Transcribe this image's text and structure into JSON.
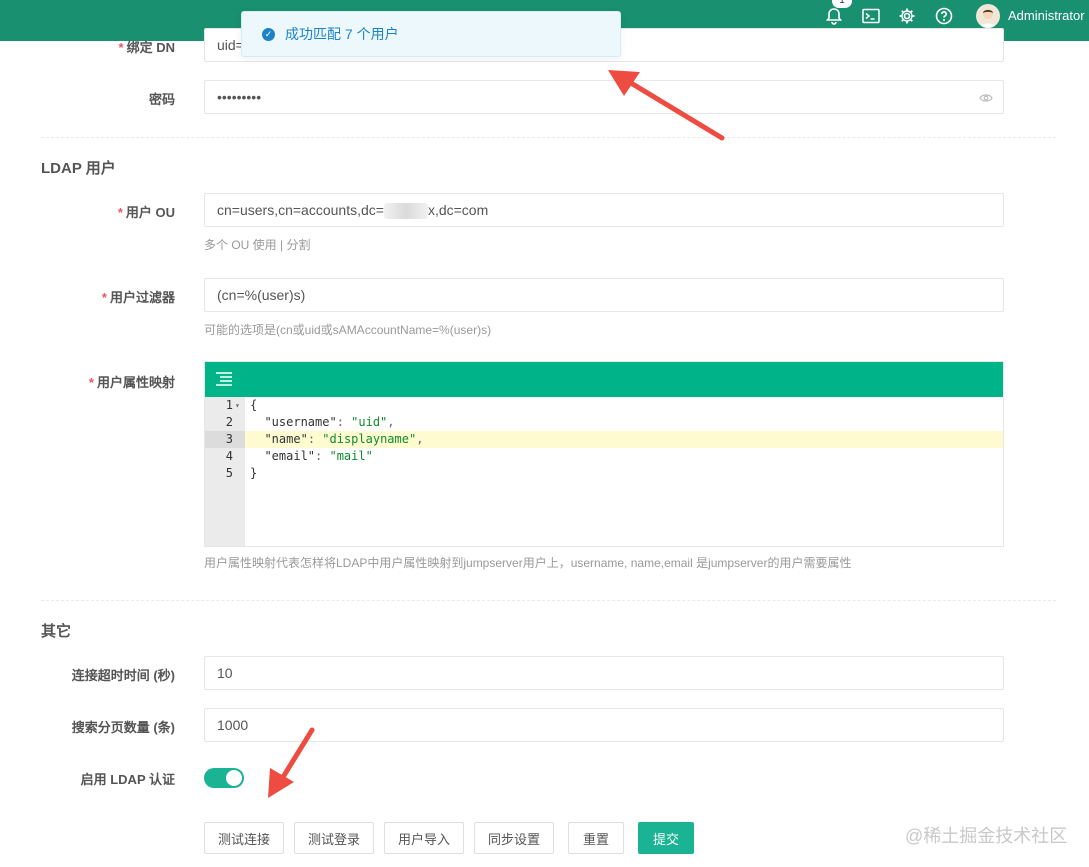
{
  "header": {
    "notification_count": "1",
    "user_name": "Administrator"
  },
  "toast": {
    "message": "成功匹配 7 个用户"
  },
  "form": {
    "bind_dn": {
      "label": "绑定 DN",
      "value": "uid="
    },
    "password": {
      "label": "密码",
      "value": "•••••••••"
    },
    "ldap_users_section": "LDAP 用户",
    "user_ou": {
      "label": "用户 OU",
      "value_prefix": "cn=users,cn=accounts,dc=",
      "value_suffix": "x,dc=com",
      "help": "多个 OU 使用 | 分割"
    },
    "user_filter": {
      "label": "用户过滤器",
      "value": "(cn=%(user)s)",
      "help": "可能的选项是(cn或uid或sAMAccountName=%(user)s)"
    },
    "attr_map": {
      "label": "用户属性映射",
      "lines": [
        {
          "n": "1",
          "open": "{"
        },
        {
          "n": "2",
          "key": "\"username\"",
          "val": "\"uid\"",
          "trail": ","
        },
        {
          "n": "3",
          "key": "\"name\"",
          "val": "\"displayname\"",
          "trail": ","
        },
        {
          "n": "4",
          "key": "\"email\"",
          "val": "\"mail\"",
          "trail": ""
        },
        {
          "n": "5",
          "open": "}"
        }
      ],
      "help": "用户属性映射代表怎样将LDAP中用户属性映射到jumpserver用户上，username, name,email 是jumpserver的用户需要属性"
    },
    "other_section": "其它",
    "timeout": {
      "label": "连接超时时间 (秒)",
      "value": "10"
    },
    "page_size": {
      "label": "搜索分页数量 (条)",
      "value": "1000"
    },
    "enable_ldap": {
      "label": "启用 LDAP 认证",
      "checked": true
    }
  },
  "buttons": {
    "test_connect": "测试连接",
    "test_login": "测试登录",
    "import_users": "用户导入",
    "sync_settings": "同步设置",
    "reset": "重置",
    "submit": "提交"
  },
  "watermark": "@稀土掘金技术社区",
  "colors": {
    "header": "#19906f",
    "primary": "#1ab394",
    "editor_toolbar": "#00b388",
    "arrow": "#ee4c40"
  }
}
